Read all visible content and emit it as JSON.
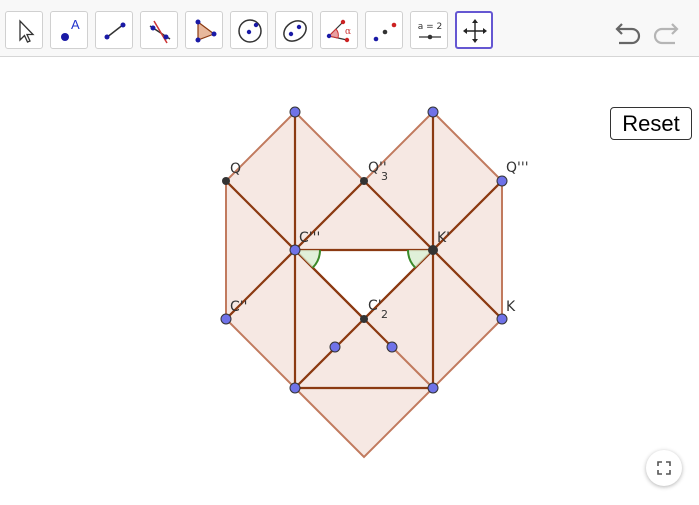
{
  "toolbar": {
    "tools": [
      {
        "name": "move",
        "icon": "pointer-arrow-icon"
      },
      {
        "name": "point",
        "icon": "point-icon",
        "label": "A"
      },
      {
        "name": "line",
        "icon": "line-icon"
      },
      {
        "name": "perpendicular-line",
        "icon": "perpendicular-line-icon"
      },
      {
        "name": "polygon",
        "icon": "polygon-icon"
      },
      {
        "name": "circle-center-point",
        "icon": "circle-center-point-icon"
      },
      {
        "name": "ellipse",
        "icon": "ellipse-icon"
      },
      {
        "name": "angle",
        "icon": "angle-icon",
        "label": "α"
      },
      {
        "name": "reflect-about-point",
        "icon": "reflect-point-icon"
      },
      {
        "name": "slider",
        "icon": "slider-icon",
        "label": "a = 2"
      },
      {
        "name": "move-graphics-view",
        "icon": "move-graphics-view-icon",
        "selected": true
      }
    ],
    "undo_icon": "undo-arrow-icon",
    "redo_icon": "redo-arrow-icon"
  },
  "reset_label": "Reset",
  "fullscreen_icon": "fullscreen-icon",
  "labels": {
    "Q": {
      "text": "Q",
      "sub": ""
    },
    "Q3": {
      "text": "Q''",
      "sub": "3"
    },
    "Q3p": {
      "text": "Q'''",
      "sub": ""
    },
    "C3": {
      "text": "C'''",
      "sub": ""
    },
    "Kp": {
      "text": "K'",
      "sub": ""
    },
    "C2": {
      "text": "C''",
      "sub": ""
    },
    "Cp2": {
      "text": "C'",
      "sub": "2"
    },
    "K": {
      "text": "K",
      "sub": ""
    }
  },
  "colors": {
    "fill": "#f5e6e0",
    "edge_light": "#c17a5e",
    "edge_dark": "#8b3a12",
    "point_free": "#6f72e8",
    "point_dependent": "#333333",
    "angle": "#3b8a2a",
    "accent": "#6557d2"
  }
}
